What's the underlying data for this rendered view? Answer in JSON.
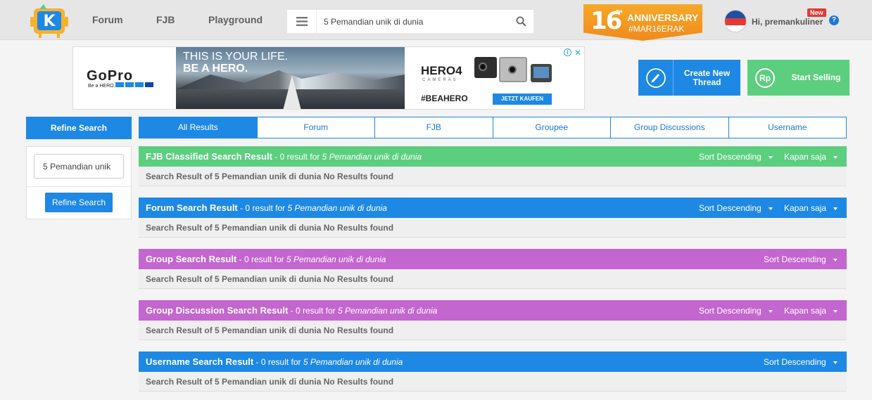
{
  "header": {
    "nav": [
      "Forum",
      "FJB",
      "Playground"
    ],
    "search": {
      "value": "5 Pemandian unik di dunia",
      "placeholder": "Search"
    },
    "anniversary": {
      "number": "16",
      "th": "TH",
      "title": "ANNIVERSARY",
      "tag": "#MAR16ERAK"
    },
    "user": {
      "greeting": "Hi, premankuliner",
      "badge": "New",
      "help": "?"
    }
  },
  "ad": {
    "brand": "GoPro",
    "brand_tagline": "Be a HERO.",
    "headline1": "THIS IS YOUR LIFE.",
    "headline2": "BE A HERO.",
    "product": "HERO4",
    "product_sub": "CAMERAS",
    "hashtag": "#BEAHERO",
    "cta": "JETZT KAUFEN",
    "info": "i",
    "close": "✕"
  },
  "actions": {
    "create_thread": "Create New Thread",
    "start_selling": "Start Selling",
    "sell_icon": "Rp"
  },
  "sidebar": {
    "title": "Refine Search",
    "input_value": "5 Pemandian unik",
    "button": "Refine Search"
  },
  "tabs": [
    "All Results",
    "Forum",
    "FJB",
    "Groupee",
    "Group Discussions",
    "Username"
  ],
  "sections": [
    {
      "title": "FJB Classified Search Result",
      "count": " - 0 result for ",
      "query": "5 Pemandian unik di dunia",
      "sort": "Sort Descending",
      "time": "Kapan saja",
      "body": "Search Result of 5 Pemandian unik di dunia No Results found",
      "color": "#5ccf7f"
    },
    {
      "title": "Forum Search Result",
      "count": " - 0 result for ",
      "query": "5 Pemandian unik di dunia",
      "sort": "Sort Descending",
      "time": "Kapan saja",
      "body": "Search Result of 5 Pemandian unik di dunia No Results found",
      "color": "#1e88e5"
    },
    {
      "title": "Group Search Result",
      "count": " - 0 result for ",
      "query": "5 Pemandian unik di dunia",
      "sort": "Sort Descending",
      "time": "",
      "body": "Search Result of 5 Pemandian unik di dunia No Results found",
      "color": "#c466cf"
    },
    {
      "title": "Group Discussion Search Result",
      "count": " - 0 result for ",
      "query": "5 Pemandian unik di dunia",
      "sort": "Sort Descending",
      "time": "Kapan saja",
      "body": "Search Result of 5 Pemandian unik di dunia No Results found",
      "color": "#c466cf"
    },
    {
      "title": "Username Search Result",
      "count": " - 0 result for ",
      "query": "5 Pemandian unik di dunia",
      "sort": "Sort Descending",
      "time": "",
      "body": "Search Result of 5 Pemandian unik di dunia No Results found",
      "color": "#1e88e5"
    }
  ],
  "colors": {
    "primary": "#1e88e5",
    "green": "#5ccf7f",
    "purple": "#c466cf",
    "accent_orange": "#f39c1f"
  }
}
